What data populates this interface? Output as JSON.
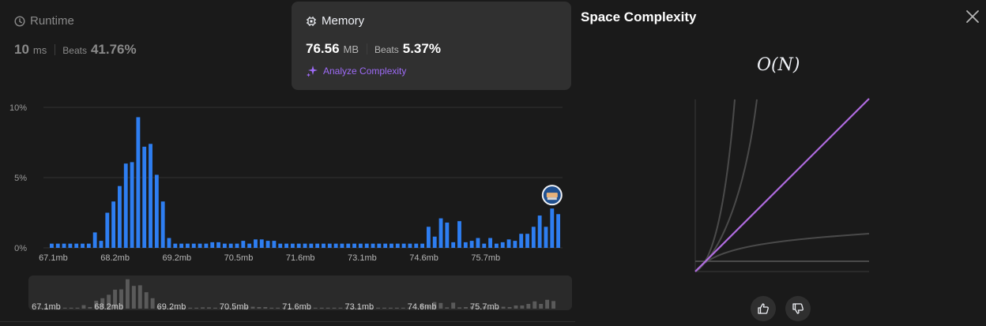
{
  "runtime": {
    "title": "Runtime",
    "value": "10",
    "unit": "ms",
    "beats_label": "Beats",
    "beats_value": "41.76%"
  },
  "memory": {
    "title": "Memory",
    "value": "76.56",
    "unit": "MB",
    "beats_label": "Beats",
    "beats_value": "5.37%",
    "analyze_label": "Analyze Complexity"
  },
  "space_complexity": {
    "title": "Space Complexity",
    "notation": "O(N)"
  },
  "colors": {
    "bar": "#2e7ef1",
    "brush_bar": "#5a5a5a",
    "accent_purple": "#9e6bf7",
    "line_purple": "#b06ce0"
  },
  "chart_data": {
    "type": "bar",
    "ylim": [
      0,
      10
    ],
    "yticks": [
      "0%",
      "5%",
      "10%"
    ],
    "x_tick_labels": [
      "67.1mb",
      "68.2mb",
      "69.2mb",
      "70.5mb",
      "71.6mb",
      "73.1mb",
      "74.6mb",
      "75.7mb"
    ],
    "x_tick_bar_index": [
      0,
      10,
      20,
      30,
      40,
      50,
      60,
      70
    ],
    "values": [
      0.3,
      0.3,
      0.3,
      0.3,
      0.3,
      0.3,
      0.3,
      1.1,
      0.5,
      2.5,
      3.3,
      4.4,
      6.0,
      6.1,
      9.3,
      7.2,
      7.4,
      5.2,
      3.3,
      0.7,
      0.3,
      0.3,
      0.3,
      0.3,
      0.3,
      0.3,
      0.4,
      0.4,
      0.3,
      0.3,
      0.3,
      0.5,
      0.3,
      0.6,
      0.6,
      0.5,
      0.5,
      0.3,
      0.3,
      0.3,
      0.3,
      0.3,
      0.3,
      0.3,
      0.3,
      0.3,
      0.3,
      0.3,
      0.3,
      0.3,
      0.3,
      0.3,
      0.3,
      0.3,
      0.3,
      0.3,
      0.3,
      0.3,
      0.3,
      0.3,
      0.3,
      1.5,
      0.8,
      2.1,
      1.8,
      0.4,
      1.9,
      0.4,
      0.5,
      0.7,
      0.3,
      0.7,
      0.3,
      0.4,
      0.6,
      0.5,
      1.0,
      1.0,
      1.5,
      2.3,
      1.5,
      2.8,
      2.4
    ],
    "highlight_index": 81
  }
}
